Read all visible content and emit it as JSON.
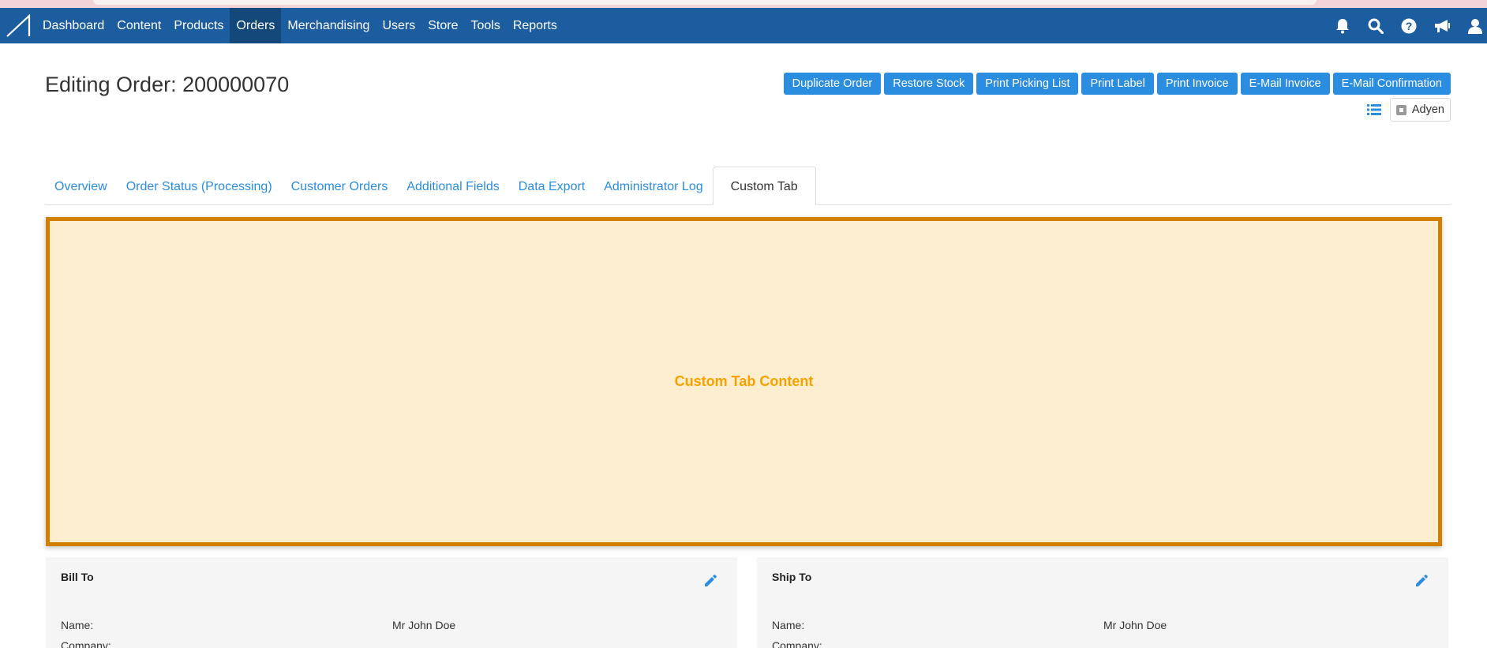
{
  "nav": {
    "items": [
      {
        "label": "Dashboard"
      },
      {
        "label": "Content"
      },
      {
        "label": "Products"
      },
      {
        "label": "Orders"
      },
      {
        "label": "Merchandising"
      },
      {
        "label": "Users"
      },
      {
        "label": "Store"
      },
      {
        "label": "Tools"
      },
      {
        "label": "Reports"
      }
    ],
    "active": "Orders",
    "icons": [
      "bell-icon",
      "search-icon",
      "help-icon",
      "megaphone-icon",
      "user-icon"
    ]
  },
  "page": {
    "title": "Editing Order: 200000070"
  },
  "actions": {
    "buttons": [
      {
        "label": "Duplicate Order"
      },
      {
        "label": "Restore Stock"
      },
      {
        "label": "Print Picking List"
      },
      {
        "label": "Print Label"
      },
      {
        "label": "Print Invoice"
      },
      {
        "label": "E-Mail Invoice"
      },
      {
        "label": "E-Mail Confirmation"
      }
    ],
    "adyen_label": "Adyen"
  },
  "tabs": {
    "items": [
      {
        "label": "Overview"
      },
      {
        "label": "Order Status (Processing)"
      },
      {
        "label": "Customer Orders"
      },
      {
        "label": "Additional Fields"
      },
      {
        "label": "Data Export"
      },
      {
        "label": "Administrator Log"
      },
      {
        "label": "Custom Tab"
      }
    ],
    "active": "Custom Tab"
  },
  "custom_tab": {
    "content": "Custom Tab Content"
  },
  "bill_to": {
    "title": "Bill To",
    "name_label": "Name:",
    "name_value": "Mr John Doe",
    "company_label": "Company:"
  },
  "ship_to": {
    "title": "Ship To",
    "name_label": "Name:",
    "name_value": "Mr John Doe",
    "company_label": "Company:"
  },
  "colors": {
    "navbar": "#1c5da0",
    "button": "#2b8de0",
    "panel_bg": "#feeed0",
    "panel_border": "#d17f00",
    "panel_text": "#f7a100"
  }
}
